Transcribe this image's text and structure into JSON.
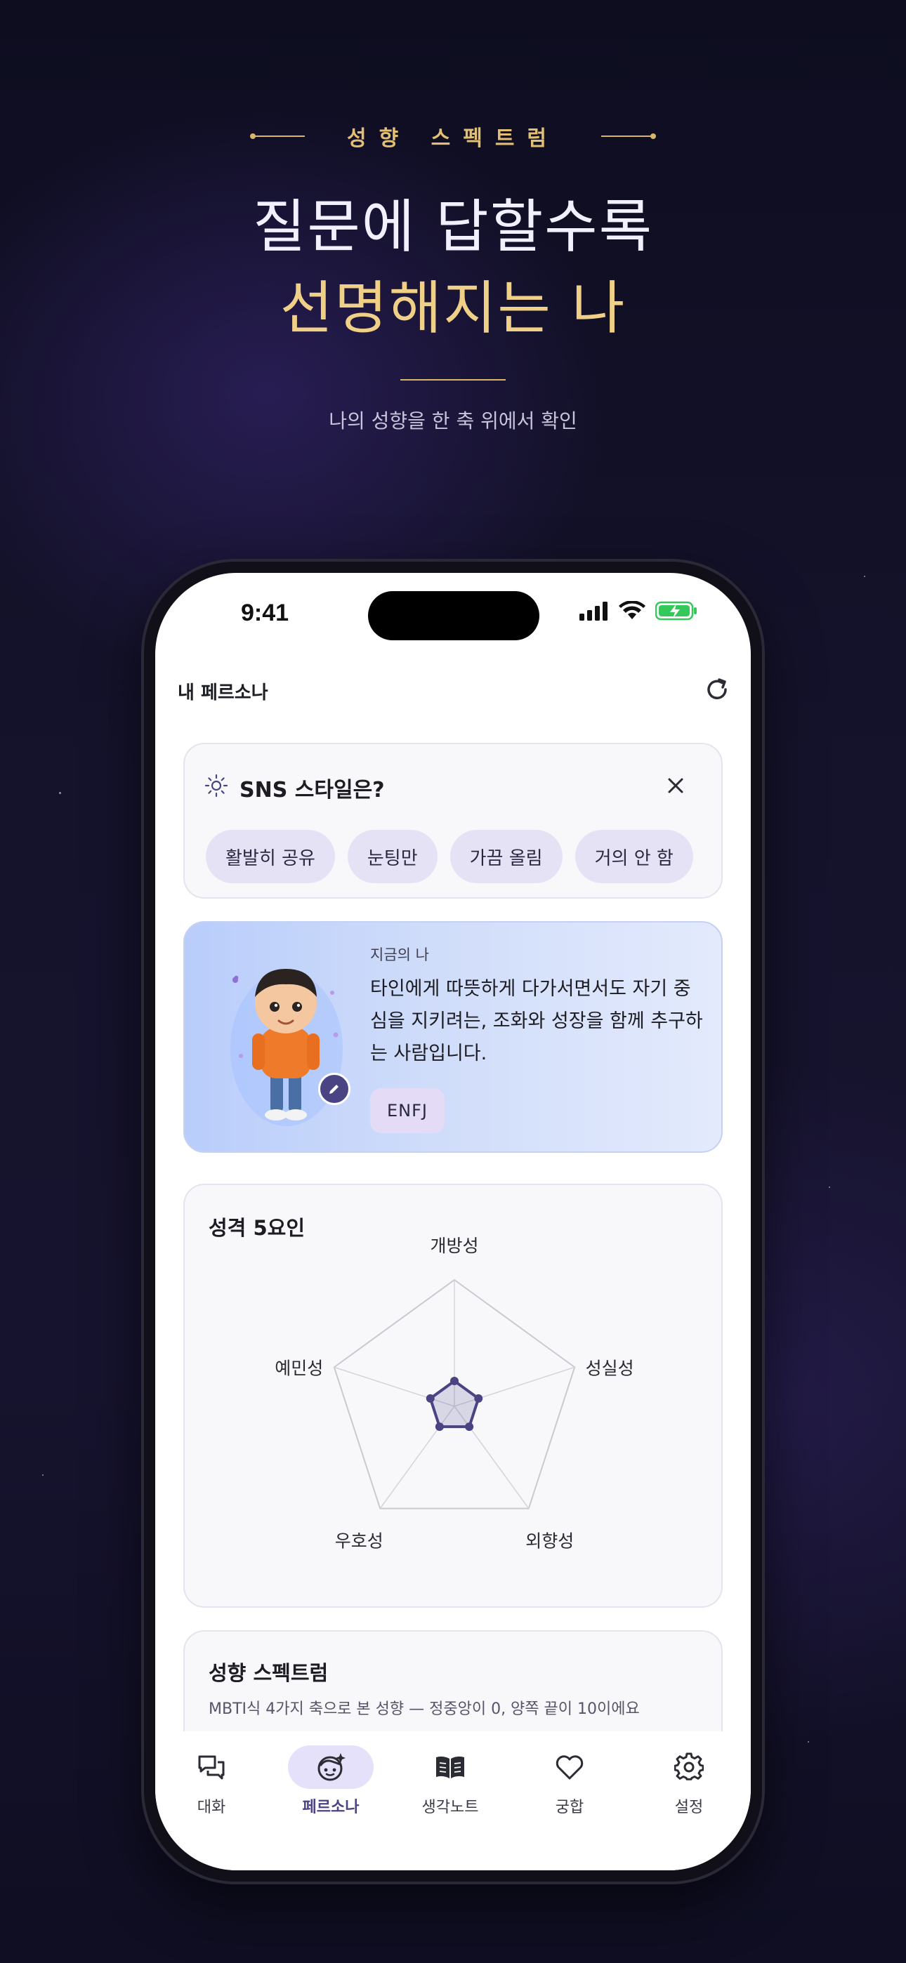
{
  "header": {
    "kicker": "성향 스펙트럼",
    "headline_line1": "질문에 답할수록",
    "headline_line2": "선명해지는 나",
    "subtitle": "나의 성향을 한 축 위에서 확인"
  },
  "status_bar": {
    "time": "9:41"
  },
  "top_bar": {
    "title": "내 페르소나"
  },
  "sns_card": {
    "question": "SNS 스타일은?",
    "options": [
      "활발히 공유",
      "눈팅만",
      "가끔 올림",
      "거의 안 함"
    ]
  },
  "persona_card": {
    "label": "지금의 나",
    "description": "타인에게 따뜻하게 다가서면서도 자기 중심을 지키려는, 조화와 성장을 함께 추구하는 사람입니다.",
    "mbti": "ENFJ"
  },
  "big5_card": {
    "title": "성격 5요인",
    "chart_data": {
      "type": "radar",
      "axes": [
        "개방성",
        "성실성",
        "외향성",
        "우호성",
        "예민성"
      ],
      "values": [
        0.2,
        0.2,
        0.2,
        0.2,
        0.2
      ],
      "range": [
        0,
        1
      ]
    }
  },
  "spectrum_card": {
    "title": "성향 스펙트럼",
    "description": "MBTI식 4가지 축으로 본 성향 — 정중앙이 0, 양쪽 끝이 10이에요"
  },
  "tabs": [
    {
      "label": "대화",
      "icon": "chat-bubbles-icon",
      "active": false
    },
    {
      "label": "페르소나",
      "icon": "persona-face-icon",
      "active": true
    },
    {
      "label": "생각노트",
      "icon": "book-icon",
      "active": false
    },
    {
      "label": "궁합",
      "icon": "heart-icon",
      "active": false
    },
    {
      "label": "설정",
      "icon": "gear-icon",
      "active": false
    }
  ],
  "colors": {
    "background": "#15132c",
    "gold_accent": "#e2bf72",
    "radar_fill": "#4a4484",
    "chip_bg": "#e6e2f6",
    "active_tab": "#4a4484"
  }
}
